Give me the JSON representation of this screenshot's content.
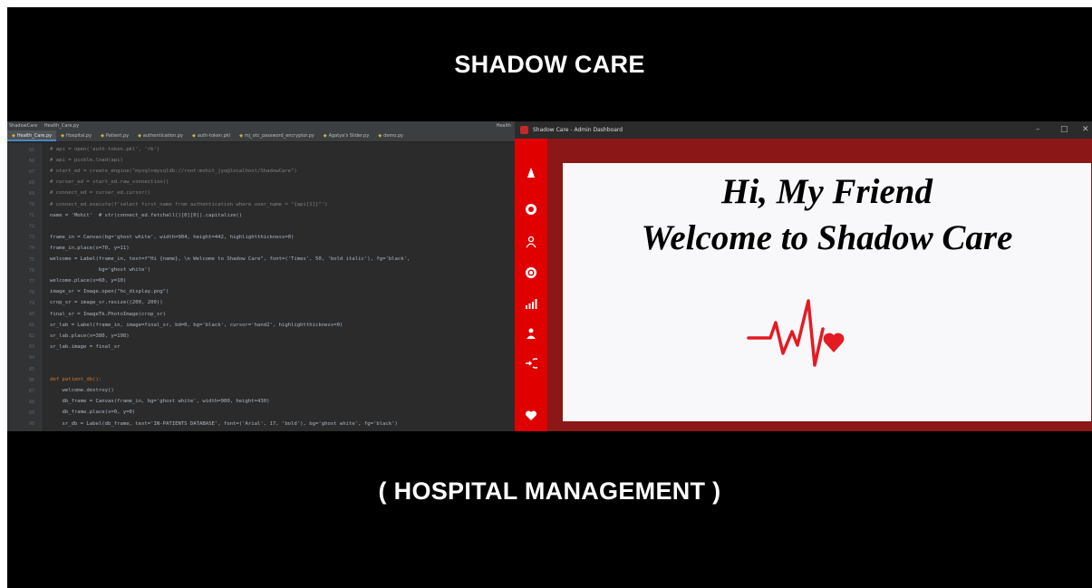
{
  "banner": {
    "title": "SHADOW CARE",
    "subtitle": "( HOSPITAL MANAGEMENT )"
  },
  "ide": {
    "breadcrumb": [
      "ShadowCare",
      "Health_Care.py"
    ],
    "top_right": "Health",
    "tabs": [
      {
        "label": "Health_Care.py",
        "active": true
      },
      {
        "label": "Hospital.py"
      },
      {
        "label": "Patient.py"
      },
      {
        "label": "authentication.py"
      },
      {
        "label": "auth-token.pkl"
      },
      {
        "label": "mj_otc_password_encryptor.py"
      },
      {
        "label": "Agatya's Slider.py"
      },
      {
        "label": "demo.py"
      }
    ],
    "lines": [
      {
        "n": "65",
        "text": "# api = open('auth-token.pkl', 'rb')",
        "type": "comment"
      },
      {
        "n": "66",
        "text": "# api = pickle.load(api)",
        "type": "comment"
      },
      {
        "n": "67",
        "text": "# start_ed = create_engine(\"mysql+mysqldb://root:mohit_jyo@localhost/ShadowCare\")",
        "type": "comment"
      },
      {
        "n": "68",
        "text": "# curser_ed = start_ed.raw_connection()",
        "type": "comment"
      },
      {
        "n": "69",
        "text": "# connect_ed = curser_ed.cursor()",
        "type": "comment"
      },
      {
        "n": "70",
        "text": "# connect_ed.execute(f'select first_name from authentication where user_name = \"{api[1]}\"')",
        "type": "comment"
      },
      {
        "n": "71",
        "text": "name = 'Mohit'  # str(connect_ed.fetchall()[0][0]).capitalize()",
        "type": "code"
      },
      {
        "n": "72",
        "text": "",
        "type": "code"
      },
      {
        "n": "73",
        "text": "frame_in = Canvas(bg='ghost white', width=904, height=442, highlightthickness=0)",
        "type": "code"
      },
      {
        "n": "74",
        "text": "frame_in.place(x=70, y=11)",
        "type": "code"
      },
      {
        "n": "75",
        "text": "welcome = Label(frame_in, text=f\"Hi {name}, \\n Welcome to Shadow Care\", font=('Times', 50, 'bold italic'), fg='black',",
        "type": "code"
      },
      {
        "n": "76",
        "text": "                bg='ghost white')",
        "type": "code"
      },
      {
        "n": "77",
        "text": "welcome.place(x=60, y=10)",
        "type": "code"
      },
      {
        "n": "78",
        "text": "image_sr = Image.open(\"hc_display.png\")",
        "type": "code"
      },
      {
        "n": "79",
        "text": "crop_sr = image_sr.resize((200, 200))",
        "type": "code"
      },
      {
        "n": "80",
        "text": "final_sr = ImageTk.PhotoImage(crop_sr)",
        "type": "code"
      },
      {
        "n": "81",
        "text": "sr_lab = Label(frame_in, image=final_sr, bd=0, bg='black', cursor='hand2', highlightthickness=0)",
        "type": "code"
      },
      {
        "n": "82",
        "text": "sr_lab.place(x=380, y=198)",
        "type": "code"
      },
      {
        "n": "83",
        "text": "sr_lab.image = final_sr",
        "type": "code"
      },
      {
        "n": "84",
        "text": "",
        "type": "code"
      },
      {
        "n": "85",
        "text": "",
        "type": "code"
      },
      {
        "n": "86",
        "text": "def patient_db():",
        "type": "def"
      },
      {
        "n": "87",
        "text": "    welcome.destroy()",
        "type": "code"
      },
      {
        "n": "88",
        "text": "    db_frame = Canvas(frame_in, bg='ghost white', width=900, height=430)",
        "type": "code"
      },
      {
        "n": "89",
        "text": "    db_frame.place(x=0, y=0)",
        "type": "code"
      },
      {
        "n": "90",
        "text": "    sr_db = Label(db_frame, text='IN-PATIENTS DATABASE', font=('Arial', 17, 'bold'), bg='ghost white', fg='black')",
        "type": "code"
      }
    ]
  },
  "admin": {
    "window_title": "Shadow Care - Admin Dashboard",
    "greeting_line1": "Hi, My Friend",
    "greeting_line2": "Welcome to Shadow Care",
    "controls": {
      "minimize": "–",
      "maximize": "□",
      "close": "✕"
    },
    "sidebar_icons": [
      "doctor-icon",
      "target-icon",
      "patient-icon",
      "search-icon",
      "chart-icon",
      "user-icon",
      "logout-icon",
      "heart-icon"
    ],
    "accent": "#e00000",
    "frame_color": "#8b1717"
  }
}
